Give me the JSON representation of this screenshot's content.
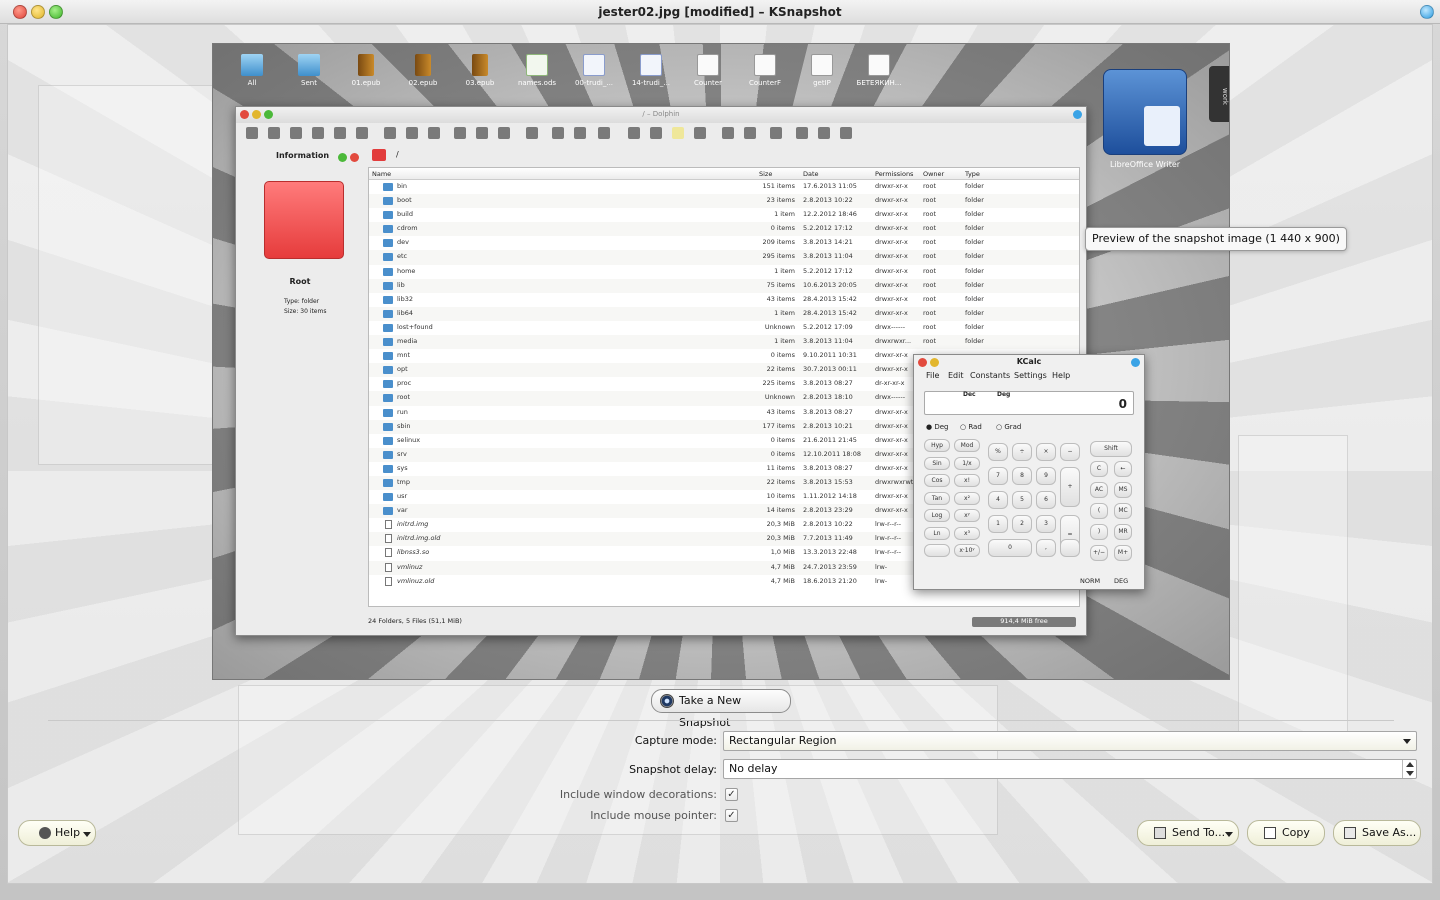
{
  "window": {
    "title": "jester02.jpg [modified] – KSnapshot"
  },
  "preview": {
    "desktop_icons": [
      "All",
      "Sent",
      "01.epub",
      "02.epub",
      "03.epub",
      "names.ods",
      "00-trudi_...",
      "14-trudi_...",
      "Counter",
      "CounterF",
      "getIP",
      "БЕТЕЯКИН..."
    ],
    "work_tab": "work",
    "libreoffice_label": "LibreOffice Writer",
    "tooltip": "Preview of the snapshot image (1 440 x 900)",
    "dolphin": {
      "title": "/ – Dolphin",
      "info_panel_title": "Information",
      "path": "/",
      "folder_name": "Root",
      "folder_type": "Type:   folder",
      "folder_size": "Size:   30 items",
      "columns": [
        "Name",
        "Size",
        "Date",
        "Permissions",
        "Owner",
        "Type"
      ],
      "rows": [
        [
          "bin",
          "151 items",
          "17.6.2013 11:05",
          "drwxr-xr-x",
          "root",
          "folder"
        ],
        [
          "boot",
          "23 items",
          "2.8.2013 10:22",
          "drwxr-xr-x",
          "root",
          "folder"
        ],
        [
          "build",
          "1 item",
          "12.2.2012 18:46",
          "drwxr-xr-x",
          "root",
          "folder"
        ],
        [
          "cdrom",
          "0 items",
          "5.2.2012 17:12",
          "drwxr-xr-x",
          "root",
          "folder"
        ],
        [
          "dev",
          "209 items",
          "3.8.2013 14:21",
          "drwxr-xr-x",
          "root",
          "folder"
        ],
        [
          "etc",
          "295 items",
          "3.8.2013 11:04",
          "drwxr-xr-x",
          "root",
          "folder"
        ],
        [
          "home",
          "1 item",
          "5.2.2012 17:12",
          "drwxr-xr-x",
          "root",
          "folder"
        ],
        [
          "lib",
          "75 items",
          "10.6.2013 20:05",
          "drwxr-xr-x",
          "root",
          "folder"
        ],
        [
          "lib32",
          "43 items",
          "28.4.2013 15:42",
          "drwxr-xr-x",
          "root",
          "folder"
        ],
        [
          "lib64",
          "1 item",
          "28.4.2013 15:42",
          "drwxr-xr-x",
          "root",
          "folder"
        ],
        [
          "lost+found",
          "Unknown",
          "5.2.2012 17:09",
          "drwx------",
          "root",
          "folder"
        ],
        [
          "media",
          "1 item",
          "3.8.2013 11:04",
          "drwxrwxr...",
          "root",
          "folder"
        ],
        [
          "mnt",
          "0 items",
          "9.10.2011 10:31",
          "drwxr-xr-x",
          "",
          ""
        ],
        [
          "opt",
          "22 items",
          "30.7.2013 00:11",
          "drwxr-xr-x",
          "",
          ""
        ],
        [
          "proc",
          "225 items",
          "3.8.2013 08:27",
          "dr-xr-xr-x",
          "",
          ""
        ],
        [
          "root",
          "Unknown",
          "2.8.2013 18:10",
          "drwx------",
          "",
          ""
        ],
        [
          "run",
          "43 items",
          "3.8.2013 08:27",
          "drwxr-xr-x",
          "",
          ""
        ],
        [
          "sbin",
          "177 items",
          "2.8.2013 10:21",
          "drwxr-xr-x",
          "",
          ""
        ],
        [
          "selinux",
          "0 items",
          "21.6.2011 21:45",
          "drwxr-xr-x",
          "",
          ""
        ],
        [
          "srv",
          "0 items",
          "12.10.2011 18:08",
          "drwxr-xr-x",
          "",
          ""
        ],
        [
          "sys",
          "11 items",
          "3.8.2013 08:27",
          "drwxr-xr-x",
          "",
          ""
        ],
        [
          "tmp",
          "22 items",
          "3.8.2013 15:53",
          "drwxrwxrwt",
          "",
          ""
        ],
        [
          "usr",
          "10 items",
          "1.11.2012 14:18",
          "drwxr-xr-x",
          "",
          ""
        ],
        [
          "var",
          "14 items",
          "2.8.2013 23:29",
          "drwxr-xr-x",
          "",
          ""
        ],
        [
          "initrd.img",
          "20,3 MiB",
          "2.8.2013 10:22",
          "lrw-r--r--",
          "",
          ""
        ],
        [
          "initrd.img.old",
          "20,3 MiB",
          "7.7.2013 11:49",
          "lrw-r--r--",
          "",
          ""
        ],
        [
          "libnss3.so",
          "1,0 MiB",
          "13.3.2013 22:48",
          "lrw-r--r--",
          "",
          ""
        ],
        [
          "vmlinuz",
          "4,7 MiB",
          "24.7.2013 23:59",
          "lrw-",
          "",
          ""
        ],
        [
          "vmlinuz.old",
          "4,7 MiB",
          "18.6.2013 21:20",
          "lrw-",
          "",
          ""
        ]
      ],
      "status": "24 Folders, 5 Files (51,1 MiB)",
      "free_space": "914,4 MiB free"
    },
    "kcalc": {
      "title": "KCalc",
      "menu": [
        "File",
        "Edit",
        "Constants",
        "Settings",
        "Help"
      ],
      "display_value": "0",
      "display_base": "Dec",
      "display_angle": "Deg",
      "radios": [
        "Deg",
        "Rad",
        "Grad"
      ],
      "left_buttons": [
        "Hyp",
        "Mod",
        "Sin",
        "1/x",
        "Cos",
        "x!",
        "Tan",
        "x²",
        "Log",
        "xʸ",
        "Ln",
        "x³",
        "",
        "x·10ʸ"
      ],
      "num_buttons": [
        "%",
        "÷",
        "×",
        "−",
        "7",
        "8",
        "9",
        "+",
        "4",
        "5",
        "6",
        "1",
        "2",
        "3",
        "=",
        "0",
        ",",
        ""
      ],
      "right_buttons": [
        "Shift",
        "C",
        "←",
        "AC",
        "MS",
        "(",
        "MC",
        ")",
        "MR",
        "+/−",
        "M+"
      ],
      "footer_norm": "NORM",
      "footer_deg": "DEG"
    }
  },
  "controls": {
    "take_snapshot": "Take a New Snapshot",
    "capture_mode_label": "Capture mode:",
    "capture_mode_value": "Rectangular Region",
    "snapshot_delay_label": "Snapshot delay:",
    "snapshot_delay_value": "No delay",
    "include_decorations_label": "Include window decorations:",
    "include_decorations_checked": true,
    "include_pointer_label": "Include mouse pointer:",
    "include_pointer_checked": true
  },
  "buttons": {
    "help": "Help",
    "send_to": "Send To...",
    "copy": "Copy",
    "save_as": "Save As..."
  }
}
